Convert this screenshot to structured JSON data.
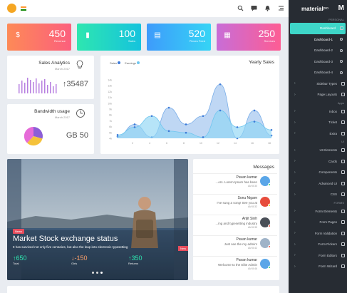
{
  "topbar": {
    "icons": [
      "logo-icon",
      "flag-icon",
      "search-icon",
      "message-icon",
      "bell-icon",
      "menu-icon"
    ]
  },
  "sidebar": {
    "brand": "material",
    "brand_suffix": "pro",
    "items": [
      {
        "type": "section",
        "label": "PERSONAL"
      },
      {
        "type": "item",
        "label": "Dashboard",
        "active": true
      },
      {
        "type": "sub",
        "label": "Dashboard-1",
        "current": true
      },
      {
        "type": "sub",
        "label": "Dashboard-2"
      },
      {
        "type": "sub",
        "label": "Dashboard-3"
      },
      {
        "type": "sub",
        "label": "Dashboard-4"
      },
      {
        "type": "item",
        "label": "Sidebar Types"
      },
      {
        "type": "item",
        "label": "Page Layouts"
      },
      {
        "type": "section",
        "label": "Apps"
      },
      {
        "type": "item",
        "label": "Inbox"
      },
      {
        "type": "item",
        "label": "Ticket"
      },
      {
        "type": "item",
        "label": "Extra"
      },
      {
        "type": "section",
        "label": "UI"
      },
      {
        "type": "item",
        "label": "UI Elements"
      },
      {
        "type": "item",
        "label": "Cards"
      },
      {
        "type": "item",
        "label": "Components"
      },
      {
        "type": "item",
        "label": "Advanced UI"
      },
      {
        "type": "item",
        "label": "CSS"
      },
      {
        "type": "section",
        "label": "FORMS"
      },
      {
        "type": "item",
        "label": "Form Elements"
      },
      {
        "type": "item",
        "label": "Form Pages"
      },
      {
        "type": "item",
        "label": "Form Validation"
      },
      {
        "type": "item",
        "label": "Form Pickers"
      },
      {
        "type": "item",
        "label": "Form Editors"
      },
      {
        "type": "item",
        "label": "Form Wizard"
      }
    ]
  },
  "stats": [
    {
      "value": "450",
      "label": "Revenue",
      "icon": "dollar-icon",
      "from": "#fd8a57",
      "to": "#fc5f7d"
    },
    {
      "value": "100",
      "label": "Sales",
      "icon": "bar-chart-icon",
      "from": "#2ee6b0",
      "to": "#15c3dd"
    },
    {
      "value": "520",
      "label": "Pieces Feed",
      "icon": "document-icon",
      "from": "#3e9bfb",
      "to": "#35d4f5"
    },
    {
      "value": "250",
      "label": "Services",
      "icon": "clipboard-icon",
      "from": "#c86dd7",
      "to": "#fd5d94"
    }
  ],
  "sales_analytics": {
    "title": "Sales Analytics",
    "date": "March 2017",
    "value": "35487",
    "arrow": "↑"
  },
  "bandwidth": {
    "title": "Bandwidth usage",
    "date": "March 2017",
    "value": "GB 50"
  },
  "yearly": {
    "title": "Yearly Sales",
    "legend": [
      "Sales",
      "Earnings"
    ]
  },
  "chart_data": {
    "type": "area",
    "title": "Yearly Sales",
    "x": [
      "0",
      "2",
      "4",
      "6",
      "8",
      "10",
      "12",
      "14",
      "16",
      "18"
    ],
    "y_ticks": [
      "14k",
      "13k",
      "12k",
      "11k",
      "10k",
      "9k",
      "8k",
      "7k",
      "6k",
      "5k",
      "4k"
    ],
    "ylim": [
      4,
      14.5
    ],
    "series": [
      {
        "name": "Sales",
        "values": [
          4.3,
          6.5,
          4.2,
          9.5,
          6.5,
          8.0,
          13.7,
          4.0,
          9.0,
          4.5
        ]
      },
      {
        "name": "Earnings",
        "values": [
          4.6,
          6.0,
          8.0,
          5.3,
          5.0,
          4.2,
          9.0,
          6.0,
          7.0,
          5.5
        ]
      }
    ]
  },
  "hero": {
    "badge": "News",
    "title": "Market Stock exchange status",
    "text": "It has survived not only five centuries, but also the leap into electronic typesetting",
    "stats": [
      {
        "value": "↑650",
        "label": "Total",
        "color": "#2ee6b0"
      },
      {
        "value": "↓-150",
        "label": "Girls",
        "color": "#fda06a"
      },
      {
        "value": "↑350",
        "label": "Returns",
        "color": "#2ee6b0"
      }
    ],
    "next_badge": "New"
  },
  "messages": {
    "title": "Messages",
    "items": [
      {
        "name": "Pavan kumar",
        "text": "...ors. Lorem Ipsum has been",
        "time": "AM 8:30",
        "avatar": "#5aa6e8",
        "status": "#2ecc71"
      },
      {
        "name": "Sonu Nigam",
        "text": "I've sung a song! See you at",
        "time": "AM 8:32",
        "avatar": "#e74c3c",
        "status": "#f1c40f"
      },
      {
        "name": "Arijit Sinh",
        "text": "...ing and typesetting industry",
        "time": "AM 8:35",
        "avatar": "#4a4f57",
        "status": "#e74c3c"
      },
      {
        "name": "Pavan kumar",
        "text": "Just see the my admin!",
        "time": "AM 8:42",
        "avatar": "#9fb3c8",
        "status": "#e74c3c"
      },
      {
        "name": "Pavan kumar",
        "text": "Welcome to the Elite Admin",
        "time": "AM 8:46",
        "avatar": "#5aa6e8",
        "status": "#2ecc71"
      }
    ]
  }
}
